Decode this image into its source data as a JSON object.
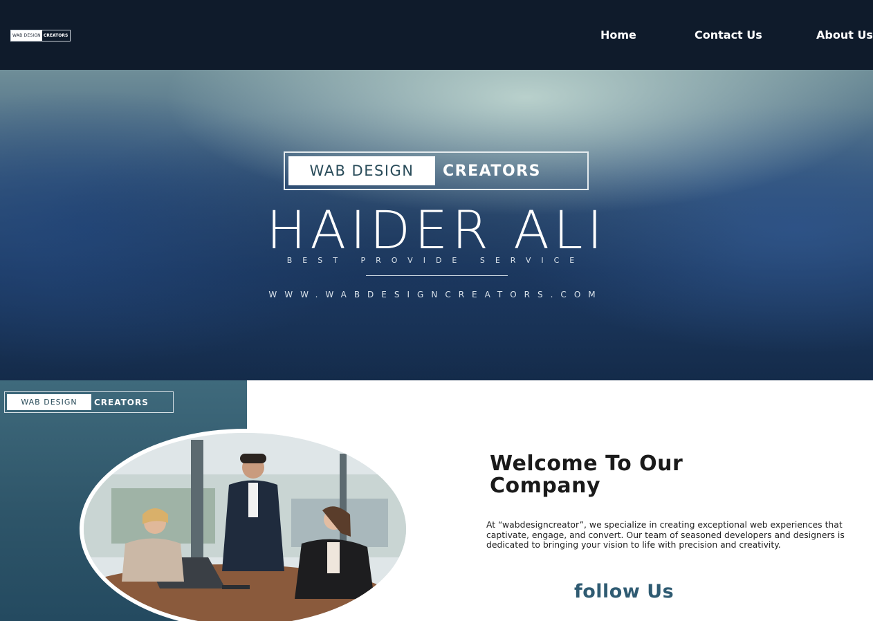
{
  "navbar": {
    "logo": {
      "part1": "WAB DESIGN",
      "part2": "CREATORS"
    },
    "links": [
      "Home",
      "Contact Us",
      "About Us"
    ]
  },
  "hero": {
    "logo": {
      "part1": "WAB DESIGN",
      "part2": "CREATORS"
    },
    "name": "HAIDER ALI",
    "tagline": "BEST PROVIDE SERVICE",
    "url": "WWW.WABDESIGNCREATORS.COM"
  },
  "about": {
    "logo": {
      "part1": "WAB DESIGN",
      "part2": "CREATORS"
    },
    "welcome_line1": "Welcome To Our",
    "welcome_line2": "Company",
    "body": "At “wabdesigncreator”, we specialize in creating exceptional web experiences that captivate, engage, and convert. Our team of seasoned developers and designers is dedicated to bringing your vision to life with precision and creativity.",
    "follow_title": "follow Us"
  },
  "colors": {
    "navbar_bg": "#0f1b2b",
    "panel_bg": "#2e5569",
    "follow_accent": "#2f5b72"
  }
}
